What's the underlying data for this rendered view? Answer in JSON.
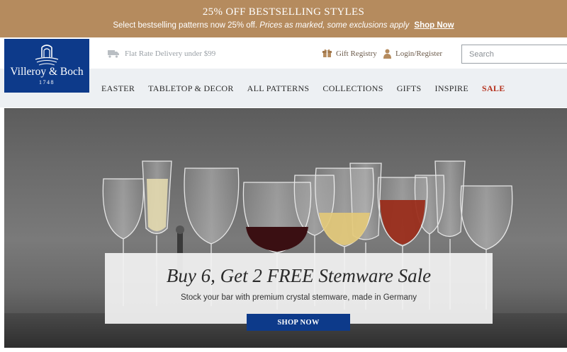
{
  "promo": {
    "title": "25% OFF BESTSELLING STYLES",
    "subtitle": "Select bestselling patterns now 25% off.",
    "note": "Prices as marked, some exclusions apply",
    "link": "Shop Now"
  },
  "brand": {
    "name": "Villeroy & Boch",
    "year": "1748",
    "color": "#0d3a8a"
  },
  "header": {
    "delivery": "Flat Rate Delivery under $99",
    "gift_registry": "Gift Registry",
    "login": "Login/Register",
    "search_placeholder": "Search"
  },
  "nav": {
    "items": [
      "EASTER",
      "TABLETOP & DECOR",
      "ALL PATTERNS",
      "COLLECTIONS",
      "GIFTS",
      "INSPIRE",
      "SALE"
    ]
  },
  "hero": {
    "title": "Buy 6, Get 2 FREE Stemware Sale",
    "subtitle": "Stock your bar with premium crystal stemware, made in Germany",
    "button": "SHOP NOW"
  },
  "colors": {
    "promo_bg": "#b58b5e",
    "sale": "#b5321e"
  }
}
